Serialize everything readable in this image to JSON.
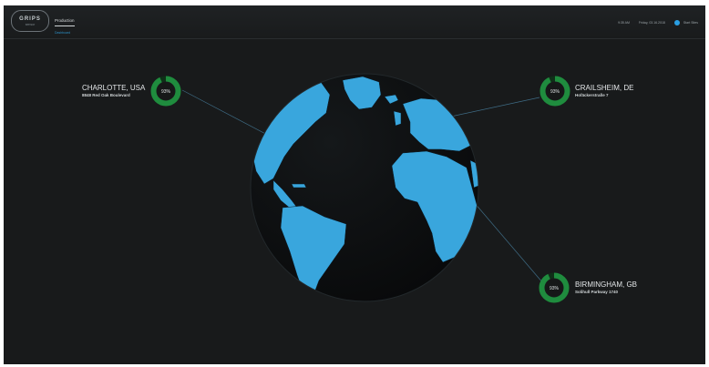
{
  "app": {
    "logo_text": "GRIPS",
    "logo_subtext": "sensor"
  },
  "nav": {
    "active_tab": "Production",
    "subnav": "Dashboard"
  },
  "status": {
    "time": "9:35 AM",
    "date": "Friday, 03.16.2018",
    "user_icon": "user-icon",
    "user": "Start Sites"
  },
  "locations": [
    {
      "name": "CHARLOTTE, USA",
      "address": "8848 Red Oak Boulevard",
      "percent_text": "93%",
      "percent": 0.93
    },
    {
      "name": "CRAILSHEIM, DE",
      "address": "Hofäckerstraße 7",
      "percent_text": "93%",
      "percent": 0.93
    },
    {
      "name": "BIRMINGHAM, GB",
      "address": "Solihull Parkway 1740",
      "percent_text": "93%",
      "percent": 0.93
    }
  ],
  "colors": {
    "background": "#181a1b",
    "ocean": "#0d0f10",
    "land": "#39a6dd",
    "ring": "#1f8c3e",
    "ring_track": "#0f2f18",
    "accent": "#2a9fe3"
  }
}
